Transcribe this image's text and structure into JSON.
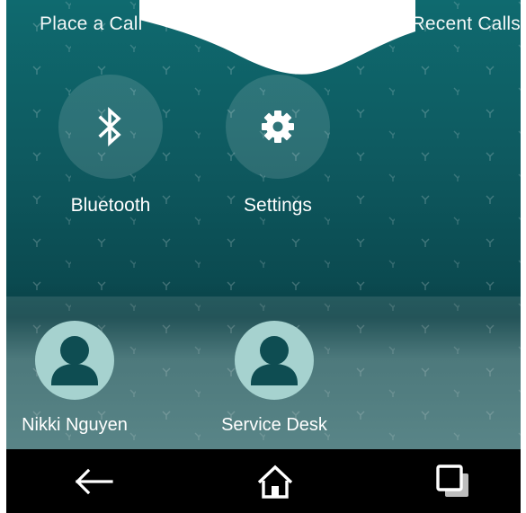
{
  "top_bar": {
    "left_label": "Place a Call",
    "right_label": "Recent Calls"
  },
  "apps": [
    {
      "label": "Bluetooth",
      "icon": "bluetooth-icon"
    },
    {
      "label": "Settings",
      "icon": "gear-icon"
    }
  ],
  "favorites": [
    {
      "name": "Nikki Nguyen",
      "icon": "person-avatar-icon"
    },
    {
      "name": "Service Desk",
      "icon": "person-avatar-icon"
    }
  ],
  "nav": {
    "back_icon": "back-arrow-icon",
    "home_icon": "home-icon",
    "recents_icon": "recent-apps-icon"
  },
  "colors": {
    "background_top": "#0f6a6f",
    "background_mid": "#0b4a50",
    "avatar": "#a6d2cf",
    "navbar": "#000000",
    "text": "#ffffff"
  }
}
